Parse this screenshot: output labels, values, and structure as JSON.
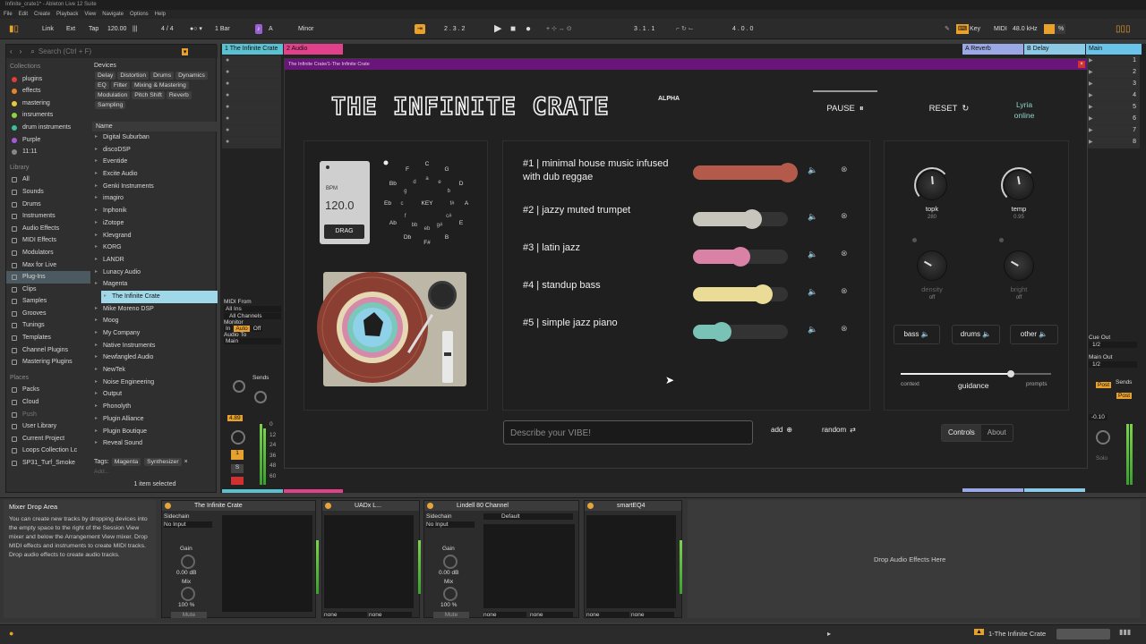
{
  "window_title": "Infinite_crate1* - Ableton Live 12 Suite",
  "menu": [
    "File",
    "Edit",
    "Create",
    "Playback",
    "View",
    "Navigate",
    "Options",
    "Help"
  ],
  "transport": {
    "link": "Link",
    "ext": "Ext",
    "tap": "Tap",
    "tempo": "120.00",
    "signature": "4 / 4",
    "quantize": "1 Bar",
    "key": "A",
    "scale": "Minor",
    "position": "2 .  3 .  2",
    "loop_start": "3 .  1 .  1",
    "loop_len": "4 .  0 .  0",
    "key_label": "Key",
    "midi_label": "MIDI",
    "sample_rate": "48.0 kHz",
    "cpu": "%"
  },
  "browser": {
    "search_placeholder": "Search (Ctrl + F)",
    "collections_label": "Collections",
    "collections": [
      {
        "label": "plugins",
        "color": "#e23b3b"
      },
      {
        "label": "effects",
        "color": "#e8832d"
      },
      {
        "label": "mastering",
        "color": "#e9c93a"
      },
      {
        "label": "insruments",
        "color": "#8ed24a"
      },
      {
        "label": "drum instruments",
        "color": "#3bbf9a"
      },
      {
        "label": "Purple",
        "color": "#a35ad8"
      },
      {
        "label": "11:11",
        "color": "#888888"
      }
    ],
    "library_label": "Library",
    "library": [
      "All",
      "Sounds",
      "Drums",
      "Instruments",
      "Audio Effects",
      "MIDI Effects",
      "Modulators",
      "Max for Live",
      "Plug-Ins",
      "Clips",
      "Samples",
      "Grooves",
      "Tunings",
      "Templates",
      "Channel Plugins",
      "Mastering Plugins"
    ],
    "places_label": "Places",
    "places": [
      "Packs",
      "Cloud",
      "Push",
      "User Library",
      "Current Project",
      "Loops Collection Lc",
      "SP31_Turf_Smoke"
    ],
    "devices_label": "Devices",
    "device_tags": [
      "Delay",
      "Distortion",
      "Drums",
      "Dynamics",
      "EQ",
      "Filter",
      "Mixing & Mastering",
      "Modulation",
      "Pitch Shift",
      "Reverb",
      "Sampling"
    ],
    "name_header": "Name",
    "folders": [
      "Digital Suburban",
      "discoDSP",
      "Eventide",
      "Excite Audio",
      "Genki Instruments",
      "imagiro",
      "Inphonik",
      "iZotope",
      "Klevgrand",
      "KORG",
      "LANDR",
      "Lunacy Audio",
      "Magenta",
      "The Infinite Crate",
      "Mike Moreno DSP",
      "Moog",
      "My Company",
      "Native Instruments",
      "Newfangled Audio",
      "NewTek",
      "Noise Engineering",
      "Output",
      "Phonolyth",
      "Plugin Alliance",
      "Plugin Boutique",
      "Reveal Sound"
    ],
    "tags_label": "Tags:",
    "tags": [
      "Magenta",
      "Synthesizer"
    ],
    "add_label": "Add...",
    "selected_info": "1 item selected"
  },
  "session": {
    "tracks": [
      {
        "name": "1 The Infinite Crate",
        "color": "#5bc0d0"
      },
      {
        "name": "2 Audio",
        "color": "#e0418a"
      }
    ],
    "returns": [
      {
        "name": "A Reverb",
        "color": "#9aa8e6"
      },
      {
        "name": "B Delay",
        "color": "#8cc9e6"
      },
      {
        "name": "Main",
        "color": "#6ac3e8"
      }
    ],
    "scene_numbers": [
      "1",
      "2",
      "3",
      "4",
      "5",
      "6",
      "7",
      "8"
    ],
    "midi_from": "MIDI From",
    "all_ins": "All Ins",
    "all_channels": "All Channels",
    "monitor": "Monitor",
    "mon_in": "In",
    "mon_auto": "Auto",
    "mon_off": "Off",
    "audio_to": "Audio To",
    "main": "Main",
    "sends": "Sends",
    "volume": "4.89",
    "track_number": "1",
    "solo": "S",
    "cue_out": "Cue Out",
    "cue_val": "1/2",
    "main_out": "Main Out",
    "main_val": "1/2",
    "post": "Post",
    "master_vol": "-0.10",
    "solo_label": "Solo",
    "meter_ticks": [
      "0",
      "12",
      "24",
      "36",
      "48",
      "60"
    ]
  },
  "plugin": {
    "window_title": "The Infinite Crate/1-The Infinite Crate",
    "title": "THE INFINITE CRATE",
    "badge": "ALPHA",
    "pause": "PAUSE",
    "reset": "RESET",
    "status_line1": "Lyria",
    "status_line2": "online",
    "bpm_label": "BPM",
    "bpm_value": "120.0",
    "drag_label": "DRAG",
    "key_label": "KEY",
    "keys_outer": [
      "C",
      "G",
      "D",
      "A",
      "E",
      "B",
      "F#",
      "Db",
      "Ab",
      "Eb",
      "Bb",
      "F"
    ],
    "keys_inner": [
      "a",
      "e",
      "b",
      "f#",
      "c#",
      "g#",
      "eb",
      "bb",
      "f",
      "c",
      "g",
      "d"
    ],
    "prompts": [
      {
        "label": "#1 | minimal house music infused with dub reggae",
        "weight": 1.0,
        "color": "#b35a4a"
      },
      {
        "label": "#2 | jazzy muted trumpet",
        "weight": 0.62,
        "color": "#c8c5bd"
      },
      {
        "label": "#3 | latin jazz",
        "weight": 0.5,
        "color": "#d982a6"
      },
      {
        "label": "#4 | standup bass",
        "weight": 0.74,
        "color": "#eadb96"
      },
      {
        "label": "#5 | simple jazz piano",
        "weight": 0.3,
        "color": "#78c3b6"
      }
    ],
    "knobs": [
      {
        "label": "topk",
        "value": "280",
        "color": "#dddddd",
        "level": 0.55
      },
      {
        "label": "temp",
        "value": "0.95",
        "color": "#dddddd",
        "level": 0.5
      },
      {
        "label": "density",
        "value": "off",
        "color": "#555555",
        "level": 0
      },
      {
        "label": "bright",
        "value": "off",
        "color": "#555555",
        "level": 0
      }
    ],
    "stems": [
      "bass",
      "drums",
      "other"
    ],
    "guidance_left": "context",
    "guidance_label": "guidance",
    "guidance_right": "prompts",
    "guidance_level": 0.73,
    "input_placeholder": "Describe your VIBE!",
    "add_label": "add",
    "random_label": "random",
    "tab_controls": "Controls",
    "tab_about": "About"
  },
  "info": {
    "title": "Mixer Drop Area",
    "text": "You can create new tracks by dropping devices into the empty space to the right of the Session View mixer and below the Arrangement View mixer. Drop MIDI effects and instruments to create MIDI tracks. Drop audio effects to create audio tracks."
  },
  "devices": [
    {
      "name": "The Infinite Crate",
      "sidechain": "Sidechain",
      "input": "No Input",
      "gain_label": "Gain",
      "gain": "0.00 dB",
      "mix_label": "Mix",
      "mix": "100 %",
      "mute": "Mute"
    },
    {
      "name": "UADx L...",
      "sel1": "none",
      "sel2": "none"
    },
    {
      "name": "Lindell 80 Channel",
      "sidechain": "Sidechain",
      "input": "No Input",
      "preset": "Default",
      "gain_label": "Gain",
      "gain": "0.00 dB",
      "mix_label": "Mix",
      "mix": "100 %",
      "mute": "Mute",
      "sel1": "none",
      "sel2": "none"
    },
    {
      "name": "smartEQ4",
      "sel1": "none",
      "sel2": "none"
    }
  ],
  "drop_text": "Drop Audio Effects Here",
  "status_track": "1-The Infinite Crate"
}
